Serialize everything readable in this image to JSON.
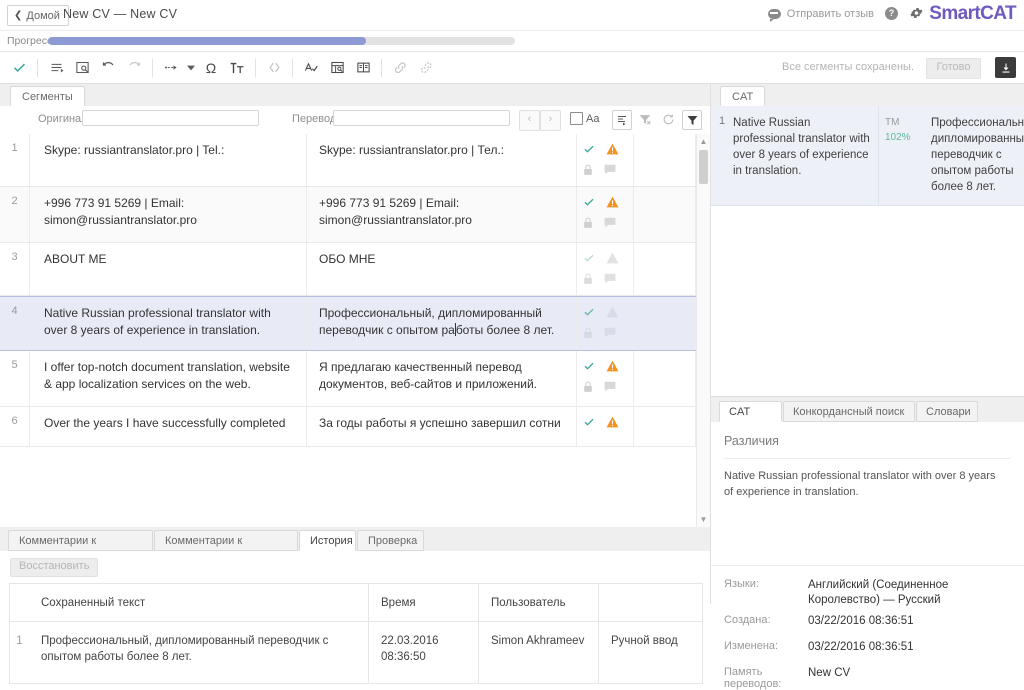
{
  "topbar": {
    "home_label": "Домой",
    "home_chevron": "chevron-left-icon",
    "doc_title": "New CV — New CV",
    "feedback_label": "Отправить отзыв",
    "help_label": "?",
    "brand": "SmartCAT"
  },
  "progress": {
    "label": "Прогресс",
    "percent": 68
  },
  "toolbar": {
    "saved_message": "Все сегменты сохранены.",
    "done_label": "Готово",
    "icons": [
      "confirm-check-icon",
      "insert-segment-icon",
      "source-copy-icon",
      "undo-icon",
      "redo-icon",
      "insert-tag-icon",
      "tag-dropdown-icon",
      "special-char-icon",
      "text-format-icon",
      "code-view-icon",
      "spellcheck-icon",
      "quality-check-icon",
      "glossary-icon",
      "add-link-icon",
      "remove-link-icon"
    ]
  },
  "left": {
    "tab_label": "Сегменты",
    "filter": {
      "original_label": "Оригинал",
      "original_value": "",
      "translation_label": "Перевод",
      "translation_value": "",
      "prev_label": "‹",
      "next_label": "›",
      "case_label": "Aa"
    },
    "segments": [
      {
        "num": "1",
        "source": "Skype: russiantranslator.pro | Tel.:",
        "target": "Skype: russiantranslator.pro | Тел.:",
        "confirmed": true,
        "warning": true,
        "locked": false,
        "comment": false,
        "selected": false
      },
      {
        "num": "2",
        "source": "+996 773 91 5269 | Email: simon@russiantranslator.pro",
        "target": "+996 773 91 5269 | Email: simon@russiantranslator.pro",
        "confirmed": true,
        "warning": true,
        "locked": false,
        "comment": false,
        "selected": false
      },
      {
        "num": "3",
        "source": "ABOUT ME",
        "target": "ОБО МНЕ",
        "confirmed": true,
        "warning": false,
        "locked": false,
        "comment": false,
        "selected": false
      },
      {
        "num": "4",
        "source": "Native Russian professional translator with over 8 years of experience in translation.",
        "target_before": "Профессиональный, дипломированный переводчик с опытом ра",
        "target_after": "боты более 8 лет.",
        "confirmed": true,
        "warning": false,
        "locked": false,
        "comment": false,
        "selected": true
      },
      {
        "num": "5",
        "source": "I offer top-notch document translation, website & app localization services on the web.",
        "target": "Я предлагаю качественный перевод документов, веб-сайтов и приложений.",
        "confirmed": true,
        "warning": true,
        "locked": false,
        "comment": false,
        "selected": false
      },
      {
        "num": "6",
        "source": "Over the years I have successfully completed",
        "target": "За годы работы я успешно завершил сотни",
        "confirmed": true,
        "warning": true,
        "locked": false,
        "comment": false,
        "selected": false
      }
    ],
    "bottom_tabs": [
      {
        "label": "Комментарии к документу",
        "active": false
      },
      {
        "label": "Комментарии к сегменту",
        "active": false
      },
      {
        "label": "История",
        "active": true
      },
      {
        "label": "Проверка",
        "active": false
      }
    ],
    "history": {
      "restore_label": "Восстановить",
      "columns": [
        "",
        "Сохраненный текст",
        "Время",
        "Пользователь",
        ""
      ],
      "rows": [
        {
          "num": "1",
          "text": "Профессиональный, дипломированный переводчик с опытом работы более 8 лет.",
          "time": "22.03.2016 08:36:50",
          "user": "Simon Akhrameev",
          "method": "Ручной ввод"
        }
      ]
    }
  },
  "right": {
    "cat_tab_label": "CAT",
    "cat_matches": [
      {
        "num": "1",
        "source": "Native Russian professional translator with over 8 years of experience in translation.",
        "engine": "TM",
        "score": "102%",
        "target": "Профессиональный, дипломированный переводчик с опытом работы более 8 лет."
      }
    ],
    "info_tabs": [
      {
        "label": "CAT инфо",
        "active": true
      },
      {
        "label": "Конкордансный поиск",
        "active": false
      },
      {
        "label": "Словари",
        "active": false
      }
    ],
    "diff_heading": "Различия",
    "diff_text": "Native Russian professional translator with over 8 years of experience in translation.",
    "meta": [
      {
        "key": "Языки:",
        "value": "Английский (Соединенное Королевство) — Русский"
      },
      {
        "key": "Создана:",
        "value": "03/22/2016 08:36:51"
      },
      {
        "key": "Изменена:",
        "value": "03/22/2016 08:36:51"
      },
      {
        "key": "Память переводов:",
        "value": "New CV"
      }
    ]
  },
  "colors": {
    "brand_purple": "#6e5bbd",
    "progress_fill": "#8e9ad4",
    "confirm_green": "#3aa99a",
    "warning_orange": "#f29222",
    "match_green": "#5bb99a",
    "selected_row": "#e8eaf6"
  }
}
